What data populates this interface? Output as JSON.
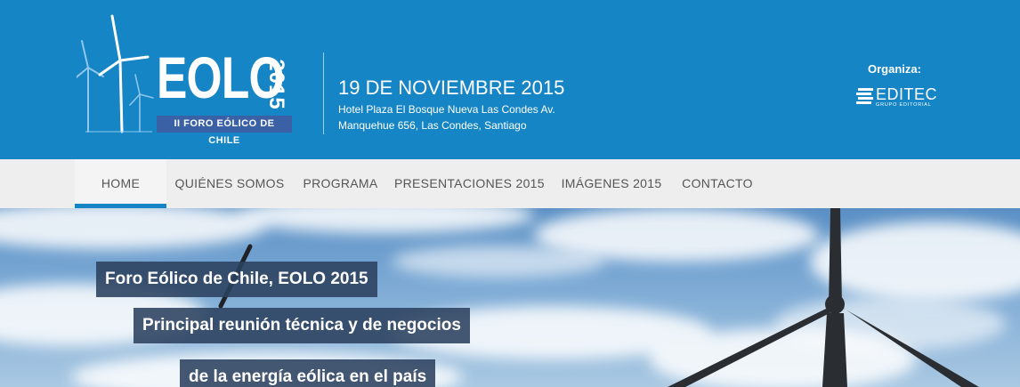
{
  "logo": {
    "word": "EOLO",
    "year": "2015",
    "subtitle": "II FORO EÓLICO DE CHILE"
  },
  "event": {
    "date": "19 DE NOVIEMBRE 2015",
    "address_line1": "Hotel Plaza El Bosque Nueva Las Condes Av.",
    "address_line2": "Manquehue 656, Las Condes, Santiago"
  },
  "organizer": {
    "label": "Organiza:",
    "name": "EDITEC",
    "tagline": "GRUPO EDITORIAL"
  },
  "nav": {
    "items": [
      {
        "label": "HOME",
        "active": true
      },
      {
        "label": "QUIÉNES SOMOS"
      },
      {
        "label": "PROGRAMA"
      },
      {
        "label": "PRESENTACIONES 2015"
      },
      {
        "label": "IMÁGENES 2015"
      },
      {
        "label": "CONTACTO"
      }
    ]
  },
  "hero": {
    "captions": [
      "Foro Eólico de Chile, EOLO 2015",
      "Principal reunión técnica y de negocios",
      "de la energía eólica en el país"
    ]
  },
  "colors": {
    "header_blue": "#1585c5",
    "nav_bg": "#eeeeee",
    "caption_bg": "#2b415f",
    "logo_sub_bg": "#3a61a6"
  }
}
